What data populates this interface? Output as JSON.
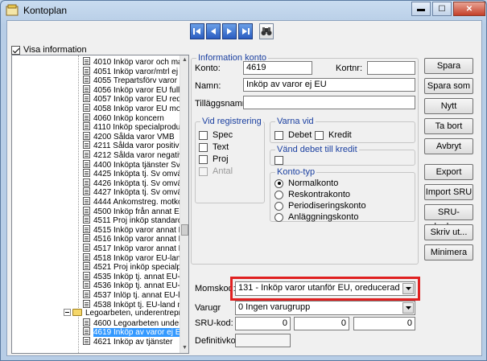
{
  "window": {
    "title": "Kontoplan",
    "minimize_glyph": "▬",
    "maximize_glyph": "☐",
    "close_glyph": "✕"
  },
  "visa_information": {
    "label": "Visa information",
    "checked": true
  },
  "tree": {
    "rows": [
      {
        "code": "4010",
        "text": "Inköp varor och mat"
      },
      {
        "code": "4051",
        "text": "Inköp varor/mtrl ej E"
      },
      {
        "code": "4055",
        "text": "Trepartsförv varor"
      },
      {
        "code": "4056",
        "text": "Inköp varor EU full r"
      },
      {
        "code": "4057",
        "text": "Inköp varor EU redu"
      },
      {
        "code": "4058",
        "text": "Inköp varor EU mom"
      },
      {
        "code": "4060",
        "text": "Inköp koncern"
      },
      {
        "code": "4110",
        "text": "Inköp specialproduk"
      },
      {
        "code": "4200",
        "text": "Sålda varor VMB"
      },
      {
        "code": "4211",
        "text": "Sålda varor positiv V"
      },
      {
        "code": "4212",
        "text": "Sålda varor negativ"
      },
      {
        "code": "4400",
        "text": "Inköpta tjänster Sv,"
      },
      {
        "code": "4425",
        "text": "Inköpta tj. Sv omvän"
      },
      {
        "code": "4426",
        "text": "Inköpta tj. Sv omvän"
      },
      {
        "code": "4427",
        "text": "Inköpta tj. Sv omvän"
      },
      {
        "code": "4444",
        "text": "Ankomstreg. motkon"
      },
      {
        "code": "4500",
        "text": "Inköp från annat EU"
      },
      {
        "code": "4511",
        "text": "Proj inköp standardp"
      },
      {
        "code": "4515",
        "text": "Inköp varor annat E"
      },
      {
        "code": "4516",
        "text": "Inköp varor annat E"
      },
      {
        "code": "4517",
        "text": "Inköp varor annat E"
      },
      {
        "code": "4518",
        "text": "Inköp varor EU-land"
      },
      {
        "code": "4521",
        "text": "Proj inköp specialpr"
      },
      {
        "code": "4535",
        "text": "Inköp tj. annat EU-la"
      },
      {
        "code": "4536",
        "text": "Inköp tj. annat EU-la"
      },
      {
        "code": "4537",
        "text": "Inlöp tj. annat EU-la"
      },
      {
        "code": "4538",
        "text": "Inköpt tj. EU-land m"
      },
      {
        "code": "",
        "text": "Legoarbeten, underentrepren",
        "folder": true
      },
      {
        "code": "4600",
        "text": "Legoarbeten undere"
      },
      {
        "code": "4619",
        "text": "Inköp av varor ej EU",
        "selected": true
      },
      {
        "code": "4621",
        "text": "Inköp av tjänster"
      }
    ]
  },
  "info": {
    "legend": "Information konto",
    "konto_label": "Konto:",
    "konto_value": "4619",
    "kortnr_label": "Kortnr:",
    "kortnr_value": "",
    "namn_label": "Namn:",
    "namn_value": "Inköp av varor ej EU",
    "tillaggsnamn_label": "Tilläggsnamn:",
    "tillaggsnamn_value": ""
  },
  "vid_registrering": {
    "legend": "Vid registrering",
    "items": [
      {
        "label": "Spec",
        "checked": false,
        "disabled": false
      },
      {
        "label": "Text",
        "checked": false,
        "disabled": false
      },
      {
        "label": "Proj",
        "checked": false,
        "disabled": false
      },
      {
        "label": "Antal",
        "checked": false,
        "disabled": true
      }
    ]
  },
  "varna_vid": {
    "legend": "Varna vid",
    "debet": "Debet",
    "kredit": "Kredit"
  },
  "vand_debet": {
    "legend": "Vänd debet till kredit"
  },
  "konto_typ": {
    "legend": "Konto-typ",
    "options": [
      {
        "label": "Normalkonto",
        "checked": true
      },
      {
        "label": "Reskontrakonto",
        "checked": false
      },
      {
        "label": "Periodiseringskonto",
        "checked": false
      },
      {
        "label": "Anläggningskonto",
        "checked": false
      }
    ]
  },
  "momskod": {
    "label": "Momskod:",
    "value": "131 - Inköp varor utanför EU, oreducerad"
  },
  "varugr": {
    "label": "Varugr",
    "value": "0  Ingen varugrupp"
  },
  "sru": {
    "label": "SRU-kod:",
    "values": [
      "0",
      "0",
      "0"
    ]
  },
  "definitiv": {
    "label": "Definitivkonto:",
    "value": ""
  },
  "buttons": {
    "spara": "Spara",
    "spara_som": "Spara som",
    "nytt": "Nytt",
    "ta_bort": "Ta bort",
    "avbryt": "Avbryt",
    "export": "Export",
    "import_sru": "Import SRU",
    "sru_koder": "SRU-koder...",
    "skriv_ut": "Skriv ut...",
    "minimera": "Minimera"
  },
  "colors": {
    "highlight": "#e02020",
    "selection": "#3399ff",
    "legend": "#1a3fa0"
  }
}
